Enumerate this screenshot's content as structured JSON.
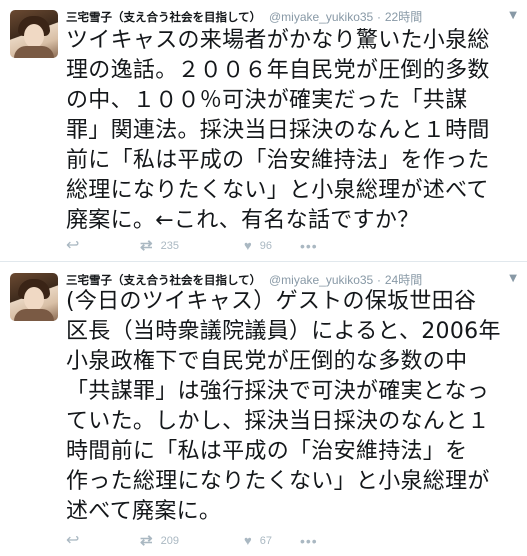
{
  "tweets": [
    {
      "name": "三宅雪子（支え合う社会を目指して）",
      "handle": "@miyake_yukiko35",
      "separator": "·",
      "time": "22時間",
      "lines": [
        "ツイキャスの来場者がかなり驚いた小泉総",
        "理の逸話。２００６年自民党が圧倒的多数",
        "の中、１００％可決が確実だった「共謀",
        "罪」関連法。採決当日採決のなんと１時間",
        "前に「私は平成の「治安維持法」を作った",
        "総理になりたくない」と小泉総理が述べて",
        "廃案に。←これ、有名な話ですか？"
      ],
      "retweets": "235",
      "likes": "96"
    },
    {
      "name": "三宅雪子（支え合う社会を目指して）",
      "handle": "@miyake_yukiko35",
      "separator": "·",
      "time": "24時間",
      "lines": [
        "(今日のツイキャス）ゲストの保坂世田谷",
        "区長（当時衆議院議員）によると、2006年",
        "小泉政権下で自民党が圧倒的な多数の中",
        "「共謀罪」は強行採決で可決が確実となっ",
        "ていた。しかし、採決当日採決のなんと１",
        "時間前に「私は平成の「治安維持法」を",
        "作った総理になりたくない」と小泉総理が",
        "述べて廃案に。"
      ],
      "retweets": "209",
      "likes": "67"
    }
  ],
  "icons": {
    "reply": "reply-icon",
    "retweet": "retweet-icon",
    "like": "heart-icon",
    "more": "more-icon",
    "caret": "chevron-down-icon"
  },
  "colors": {
    "text": "#14171a",
    "muted": "#8899a6",
    "icon": "#aab8c2",
    "divider": "#e1e8ed"
  }
}
